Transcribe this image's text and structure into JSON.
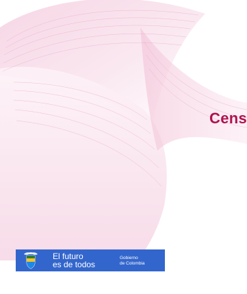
{
  "title": "Censo",
  "gov_bar": {
    "slogan_line1": "El futuro",
    "slogan_line2": "es de todos",
    "gov_line1": "Gobierno",
    "gov_line2": "de Colombia"
  },
  "colors": {
    "title": "#b0124f",
    "gov_bar_background": "#3366cc",
    "ribbon_pink": "#e9a7c3"
  },
  "icons": {
    "coat_of_arms": "colombia-coat-of-arms-icon"
  }
}
